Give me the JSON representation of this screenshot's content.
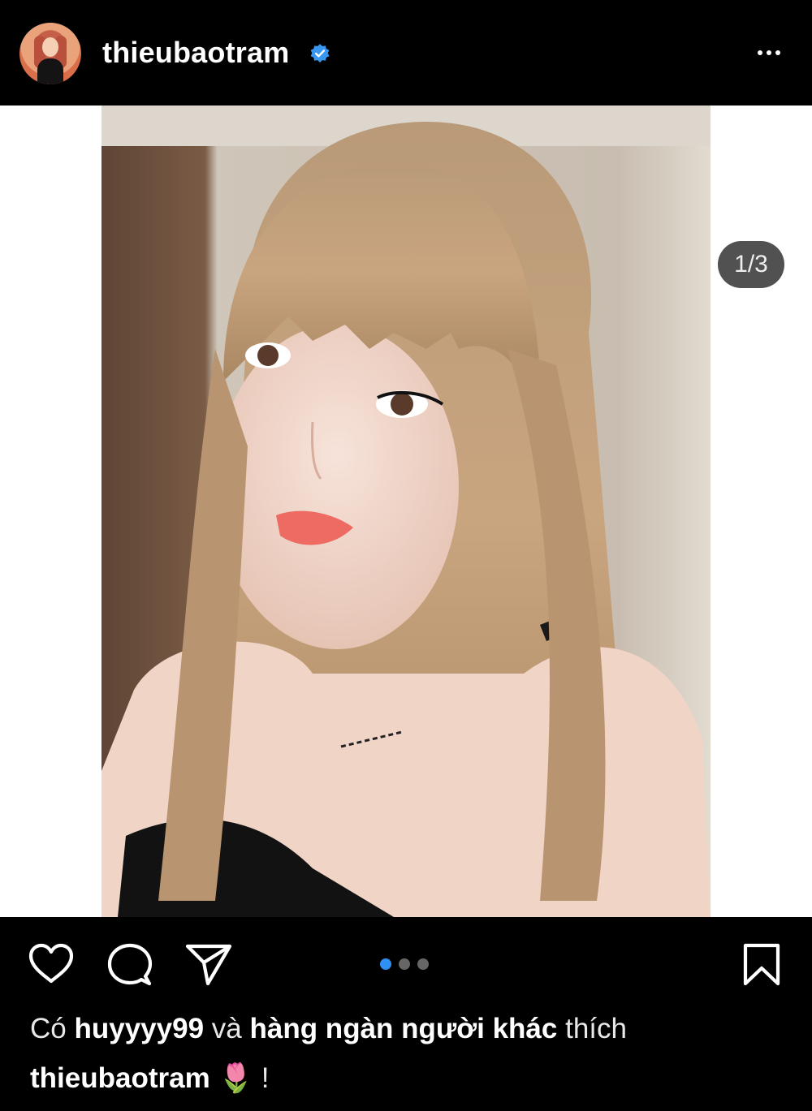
{
  "post": {
    "username": "thieubaotram",
    "verified": true,
    "image_counter": "1/3",
    "carousel": {
      "total": 3,
      "active_index": 0
    }
  },
  "likes": {
    "prefix": "Có",
    "user": "huyyyy99",
    "connector": "và",
    "others": "hàng ngàn người khác",
    "suffix": "thích"
  },
  "caption": {
    "username": "thieubaotram",
    "text": "🌷 !"
  },
  "icons": {
    "like": "heart-icon",
    "comment": "comment-icon",
    "share": "send-icon",
    "save": "bookmark-icon",
    "more": "more-icon",
    "verified": "verified-badge-icon"
  },
  "colors": {
    "background": "#000000",
    "verified_blue": "#3897f0",
    "active_dot": "#2f8ff5"
  }
}
